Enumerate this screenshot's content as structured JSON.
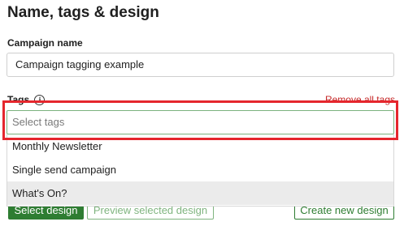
{
  "section": {
    "title": "Name, tags & design"
  },
  "campaign_name": {
    "label": "Campaign name",
    "value": "Campaign tagging example"
  },
  "tags": {
    "label": "Tags",
    "info_icon": "info-icon",
    "remove_all_label": "Remove all tags",
    "placeholder": "Select tags",
    "options": [
      "Monthly Newsletter",
      "Single send campaign",
      "What's On?"
    ],
    "hovered_option": "What's On?"
  },
  "actions": {
    "select_design": "Select design",
    "preview_design": "Preview selected design",
    "create_design": "Create new design"
  },
  "colors": {
    "accent_green": "#2e7d32",
    "highlight_red": "#e5262d",
    "link_red": "#c62828"
  }
}
